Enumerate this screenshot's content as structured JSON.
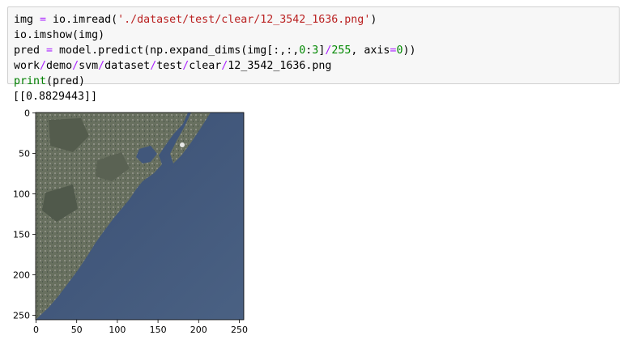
{
  "cell": {
    "lines": [
      {
        "parts": [
          {
            "t": "img ",
            "c": ""
          },
          {
            "t": "=",
            "c": "op"
          },
          {
            "t": " io.imread(",
            "c": ""
          },
          {
            "t": "'./dataset/test/clear/12_3542_1636.png'",
            "c": "str"
          },
          {
            "t": ")",
            "c": ""
          }
        ]
      },
      {
        "parts": [
          {
            "t": "io.imshow(img)",
            "c": ""
          }
        ]
      },
      {
        "parts": [
          {
            "t": "pred ",
            "c": ""
          },
          {
            "t": "=",
            "c": "op"
          },
          {
            "t": " model.predict(np.expand_dims(img[:,:,",
            "c": ""
          },
          {
            "t": "0",
            "c": "num"
          },
          {
            "t": ":",
            "c": ""
          },
          {
            "t": "3",
            "c": "num"
          },
          {
            "t": "]",
            "c": ""
          },
          {
            "t": "/",
            "c": "op"
          },
          {
            "t": "255",
            "c": "num"
          },
          {
            "t": ", axis",
            "c": ""
          },
          {
            "t": "=",
            "c": "op"
          },
          {
            "t": "0",
            "c": "num"
          },
          {
            "t": "))",
            "c": ""
          }
        ]
      },
      {
        "parts": [
          {
            "t": "work",
            "c": ""
          },
          {
            "t": "/",
            "c": "op"
          },
          {
            "t": "demo",
            "c": ""
          },
          {
            "t": "/",
            "c": "op"
          },
          {
            "t": "svm",
            "c": ""
          },
          {
            "t": "/",
            "c": "op"
          },
          {
            "t": "dataset",
            "c": ""
          },
          {
            "t": "/",
            "c": "op"
          },
          {
            "t": "test",
            "c": ""
          },
          {
            "t": "/",
            "c": "op"
          },
          {
            "t": "clear",
            "c": ""
          },
          {
            "t": "/",
            "c": "op"
          },
          {
            "t": "12_3542_1636.png",
            "c": ""
          }
        ]
      },
      {
        "parts": [
          {
            "t": "print",
            "c": "kw"
          },
          {
            "t": "(pred)",
            "c": ""
          }
        ]
      }
    ]
  },
  "output": {
    "text": "[[0.8829443]]"
  },
  "plot": {
    "x_ticks": [
      "0",
      "50",
      "100",
      "150",
      "200",
      "250"
    ],
    "y_ticks": [
      "0",
      "50",
      "100",
      "150",
      "200",
      "250"
    ],
    "x_tick_values": [
      0,
      50,
      100,
      150,
      200,
      250
    ],
    "y_tick_values": [
      0,
      50,
      100,
      150,
      200,
      250
    ],
    "extent": 256,
    "colors": {
      "sea": "#3e5478",
      "land": "#6b7461",
      "frame": "#000000"
    }
  }
}
